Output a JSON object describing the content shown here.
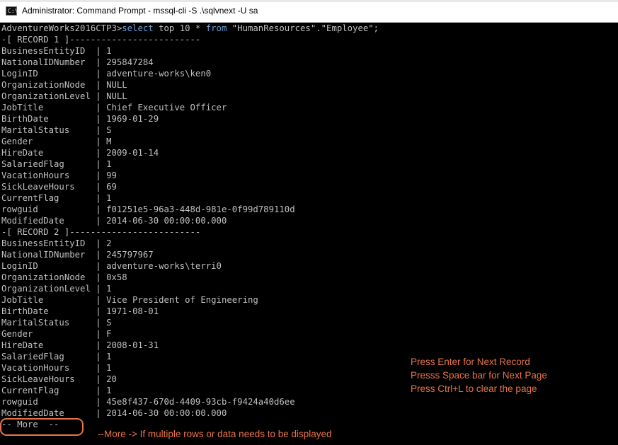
{
  "window": {
    "title": "Administrator: Command Prompt - mssql-cli  -S .\\sqlvnext -U sa",
    "icon": "command-prompt-icon"
  },
  "console": {
    "prompt": "AdventureWorks2016CTP3>",
    "command": {
      "select": "select",
      "mid": " top 10 * ",
      "from": "from",
      "rest": " \"HumanResources\".\"Employee\";"
    },
    "records": [
      {
        "header": "-[ RECORD 1 ]-------------------------",
        "fields": [
          {
            "name": "BusinessEntityID",
            "value": "1"
          },
          {
            "name": "NationalIDNumber",
            "value": "295847284"
          },
          {
            "name": "LoginID",
            "value": "adventure-works\\ken0"
          },
          {
            "name": "OrganizationNode",
            "value": "NULL"
          },
          {
            "name": "OrganizationLevel",
            "value": "NULL"
          },
          {
            "name": "JobTitle",
            "value": "Chief Executive Officer"
          },
          {
            "name": "BirthDate",
            "value": "1969-01-29"
          },
          {
            "name": "MaritalStatus",
            "value": "S"
          },
          {
            "name": "Gender",
            "value": "M"
          },
          {
            "name": "HireDate",
            "value": "2009-01-14"
          },
          {
            "name": "SalariedFlag",
            "value": "1"
          },
          {
            "name": "VacationHours",
            "value": "99"
          },
          {
            "name": "SickLeaveHours",
            "value": "69"
          },
          {
            "name": "CurrentFlag",
            "value": "1"
          },
          {
            "name": "rowguid",
            "value": "f01251e5-96a3-448d-981e-0f99d789110d"
          },
          {
            "name": "ModifiedDate",
            "value": "2014-06-30 00:00:00.000"
          }
        ]
      },
      {
        "header": "-[ RECORD 2 ]-------------------------",
        "fields": [
          {
            "name": "BusinessEntityID",
            "value": "2"
          },
          {
            "name": "NationalIDNumber",
            "value": "245797967"
          },
          {
            "name": "LoginID",
            "value": "adventure-works\\terri0"
          },
          {
            "name": "OrganizationNode",
            "value": "0x58"
          },
          {
            "name": "OrganizationLevel",
            "value": "1"
          },
          {
            "name": "JobTitle",
            "value": "Vice President of Engineering"
          },
          {
            "name": "BirthDate",
            "value": "1971-08-01"
          },
          {
            "name": "MaritalStatus",
            "value": "S"
          },
          {
            "name": "Gender",
            "value": "F"
          },
          {
            "name": "HireDate",
            "value": "2008-01-31"
          },
          {
            "name": "SalariedFlag",
            "value": "1"
          },
          {
            "name": "VacationHours",
            "value": "1"
          },
          {
            "name": "SickLeaveHours",
            "value": "20"
          },
          {
            "name": "CurrentFlag",
            "value": "1"
          },
          {
            "name": "rowguid",
            "value": "45e8f437-670d-4409-93cb-f9424a40d6ee"
          },
          {
            "name": "ModifiedDate",
            "value": "2014-06-30 00:00:00.000"
          }
        ]
      }
    ],
    "more": "-- More  --"
  },
  "annotations": {
    "notes": [
      "Press Enter for Next Record",
      "Presss Space bar for Next Page",
      "Press Ctrl+L to clear the page"
    ],
    "more_note": "--More -> If multiple rows or data needs to be displayed"
  },
  "colors": {
    "background": "#000000",
    "text": "#c0c0c0",
    "keyword": "#6aa0d8",
    "annotation": "#e8734a"
  }
}
